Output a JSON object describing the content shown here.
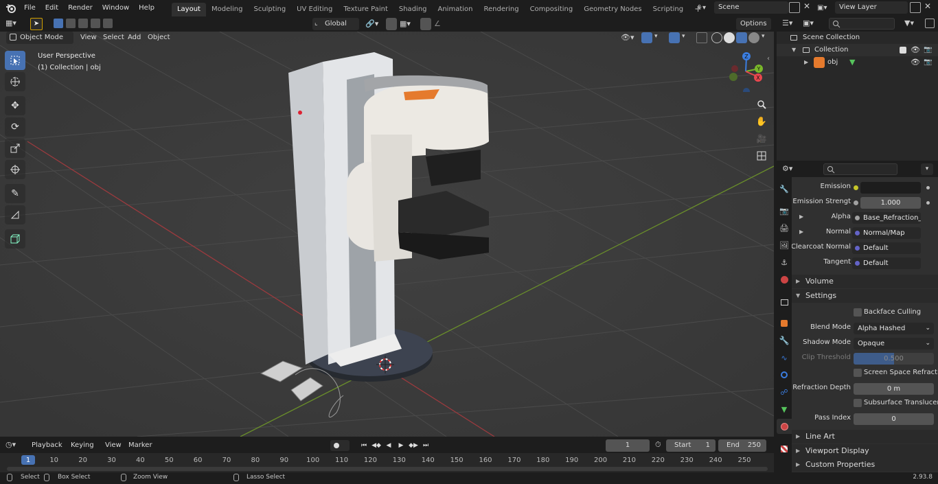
{
  "menubar": {
    "items": [
      "File",
      "Edit",
      "Render",
      "Window",
      "Help"
    ],
    "workspaces": [
      "Layout",
      "Modeling",
      "Sculpting",
      "UV Editing",
      "Texture Paint",
      "Shading",
      "Animation",
      "Rendering",
      "Compositing",
      "Geometry Nodes",
      "Scripting"
    ],
    "active_workspace": "Layout",
    "add_tab": "+",
    "scene_label": "Scene",
    "view_layer_label": "View Layer"
  },
  "viewport": {
    "mode": "Object Mode",
    "menus": [
      "View",
      "Select",
      "Add",
      "Object"
    ],
    "transform_orientation": "Global",
    "options_label": "Options",
    "perspective_label": "User Perspective",
    "collection_label": "(1) Collection | obj",
    "gizmo_axes": {
      "x": "X",
      "y": "Y",
      "z": "Z"
    }
  },
  "outliner": {
    "scene_collection": "Scene Collection",
    "collection": "Collection",
    "object": "obj"
  },
  "properties": {
    "rows": [
      {
        "label": "Emission",
        "value": ""
      },
      {
        "label": "Emission Strengt",
        "value": "1.000"
      },
      {
        "label": "Alpha",
        "value": "Base_Refraction_inv..."
      },
      {
        "label": "Normal",
        "value": "Normal/Map"
      },
      {
        "label": "Clearcoat Normal",
        "value": "Default"
      },
      {
        "label": "Tangent",
        "value": "Default"
      }
    ],
    "volume_panel": "Volume",
    "settings_panel": "Settings",
    "backface_culling": "Backface Culling",
    "blend_mode_label": "Blend Mode",
    "blend_mode_value": "Alpha Hashed",
    "shadow_mode_label": "Shadow Mode",
    "shadow_mode_value": "Opaque",
    "clip_threshold_label": "Clip Threshold",
    "clip_threshold_value": "0.500",
    "clip_threshold_fraction": 0.5,
    "screen_space_refraction": "Screen Space Refraction",
    "refraction_depth_label": "Refraction Depth",
    "refraction_depth_value": "0 m",
    "subsurface_translucency": "Subsurface Translucency",
    "pass_index_label": "Pass Index",
    "pass_index_value": "0",
    "line_art_panel": "Line Art",
    "viewport_display_panel": "Viewport Display",
    "custom_properties_panel": "Custom Properties"
  },
  "timeline": {
    "menus": [
      "Playback",
      "Keying",
      "View",
      "Marker"
    ],
    "current_frame": "1",
    "start_label": "Start",
    "start_value": "1",
    "end_label": "End",
    "end_value": "250",
    "ticks": [
      "1",
      "10",
      "20",
      "30",
      "40",
      "50",
      "60",
      "70",
      "80",
      "90",
      "100",
      "110",
      "120",
      "130",
      "140",
      "150",
      "160",
      "170",
      "180",
      "190",
      "200",
      "210",
      "220",
      "230",
      "240",
      "250"
    ]
  },
  "statusbar": {
    "select": "Select",
    "box_select": "Box Select",
    "zoom_view": "Zoom View",
    "lasso_select": "Lasso Select",
    "version": "2.93.8"
  },
  "colors": {
    "accent": "#4772b3",
    "axis_x": "#e8474e",
    "axis_y": "#7ab82a",
    "axis_z": "#3b7de0",
    "orange": "#e57a2d"
  }
}
